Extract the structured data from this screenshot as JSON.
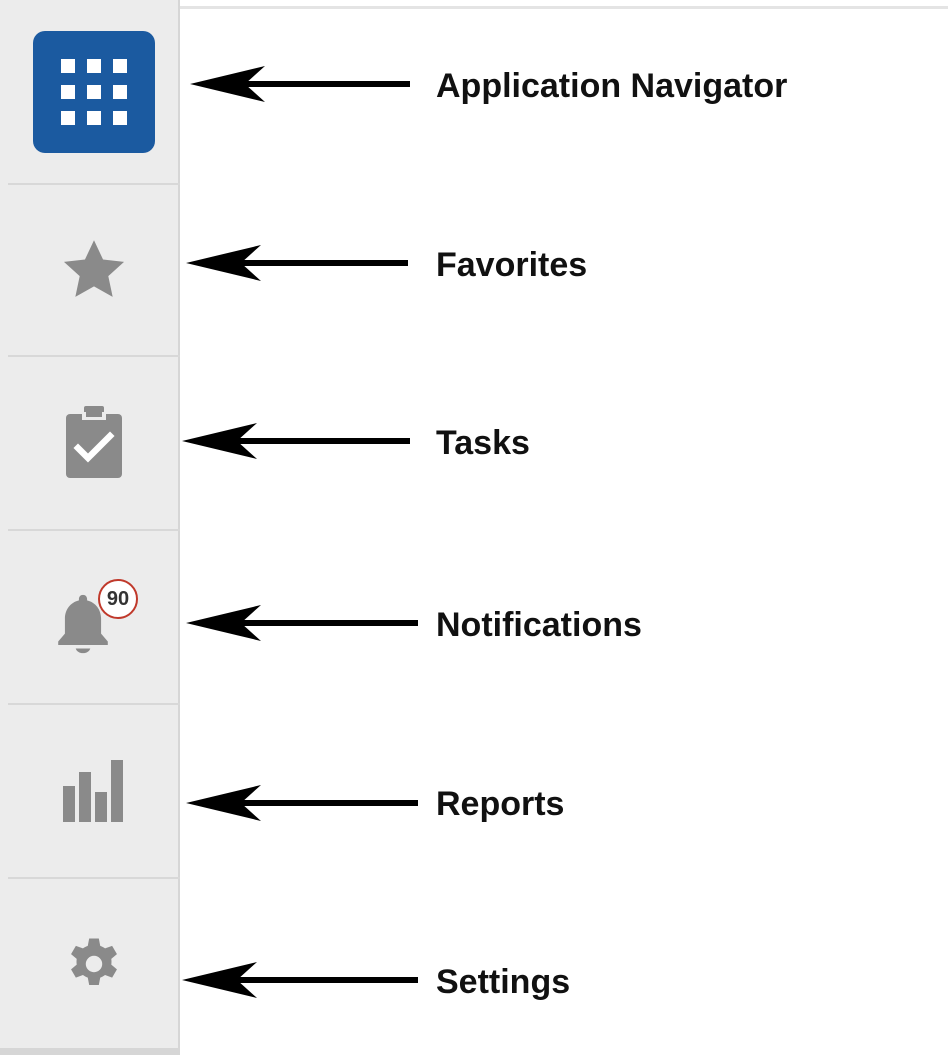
{
  "sidebar": {
    "items": [
      {
        "label": "Application Navigator",
        "icon": "apps-grid-icon"
      },
      {
        "label": "Favorites",
        "icon": "star-icon"
      },
      {
        "label": "Tasks",
        "icon": "clipboard-check-icon"
      },
      {
        "label": "Notifications",
        "icon": "bell-icon",
        "badge": "90"
      },
      {
        "label": "Reports",
        "icon": "bar-chart-icon"
      },
      {
        "label": "Settings",
        "icon": "gear-icon"
      }
    ]
  },
  "colors": {
    "accent": "#1b5aa0",
    "icon_gray": "#8a8a8a",
    "sidebar_bg": "#ececec",
    "badge_border": "#c0392b"
  }
}
